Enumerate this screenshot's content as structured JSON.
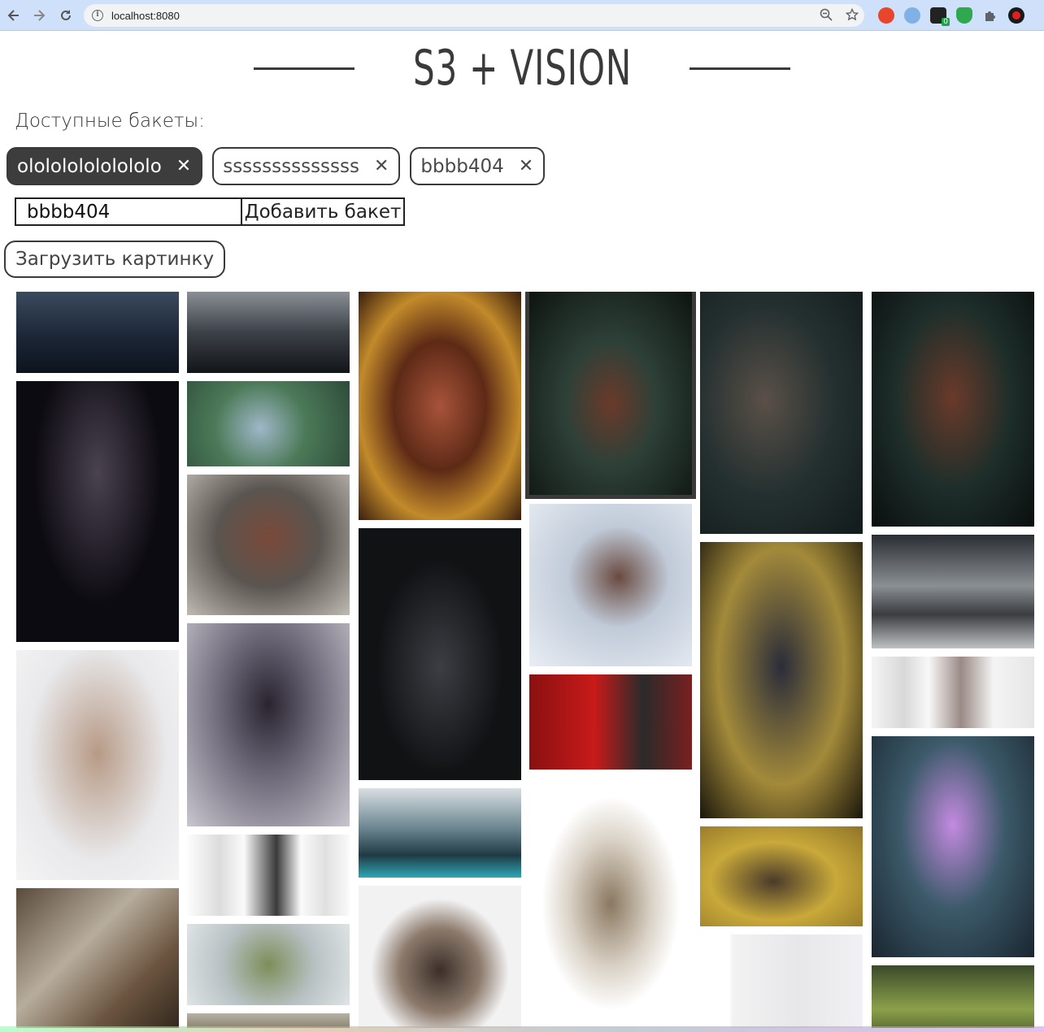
{
  "browser": {
    "url": "localhost:8080",
    "icons": [
      "back-icon",
      "forward-icon",
      "reload-icon",
      "site-info-icon",
      "zoom-icon",
      "bookmark-star-icon"
    ],
    "extension_badge": "0"
  },
  "header": {
    "title": "S3 + VISION"
  },
  "buckets": {
    "label": "Доступные бакеты:",
    "items": [
      {
        "name": "ololololololololo",
        "active": true
      },
      {
        "name": "ssssssssssssss",
        "active": false
      },
      {
        "name": "bbbb404",
        "active": false
      }
    ],
    "remove_glyph": "✕"
  },
  "add_bucket": {
    "input_value": "bbbb404",
    "button_label": "Добавить бакет"
  },
  "upload": {
    "button_label": "Загрузить картинку"
  },
  "colors": {
    "primary": "#3a3a3a",
    "chrome": "#cfe0fb"
  }
}
